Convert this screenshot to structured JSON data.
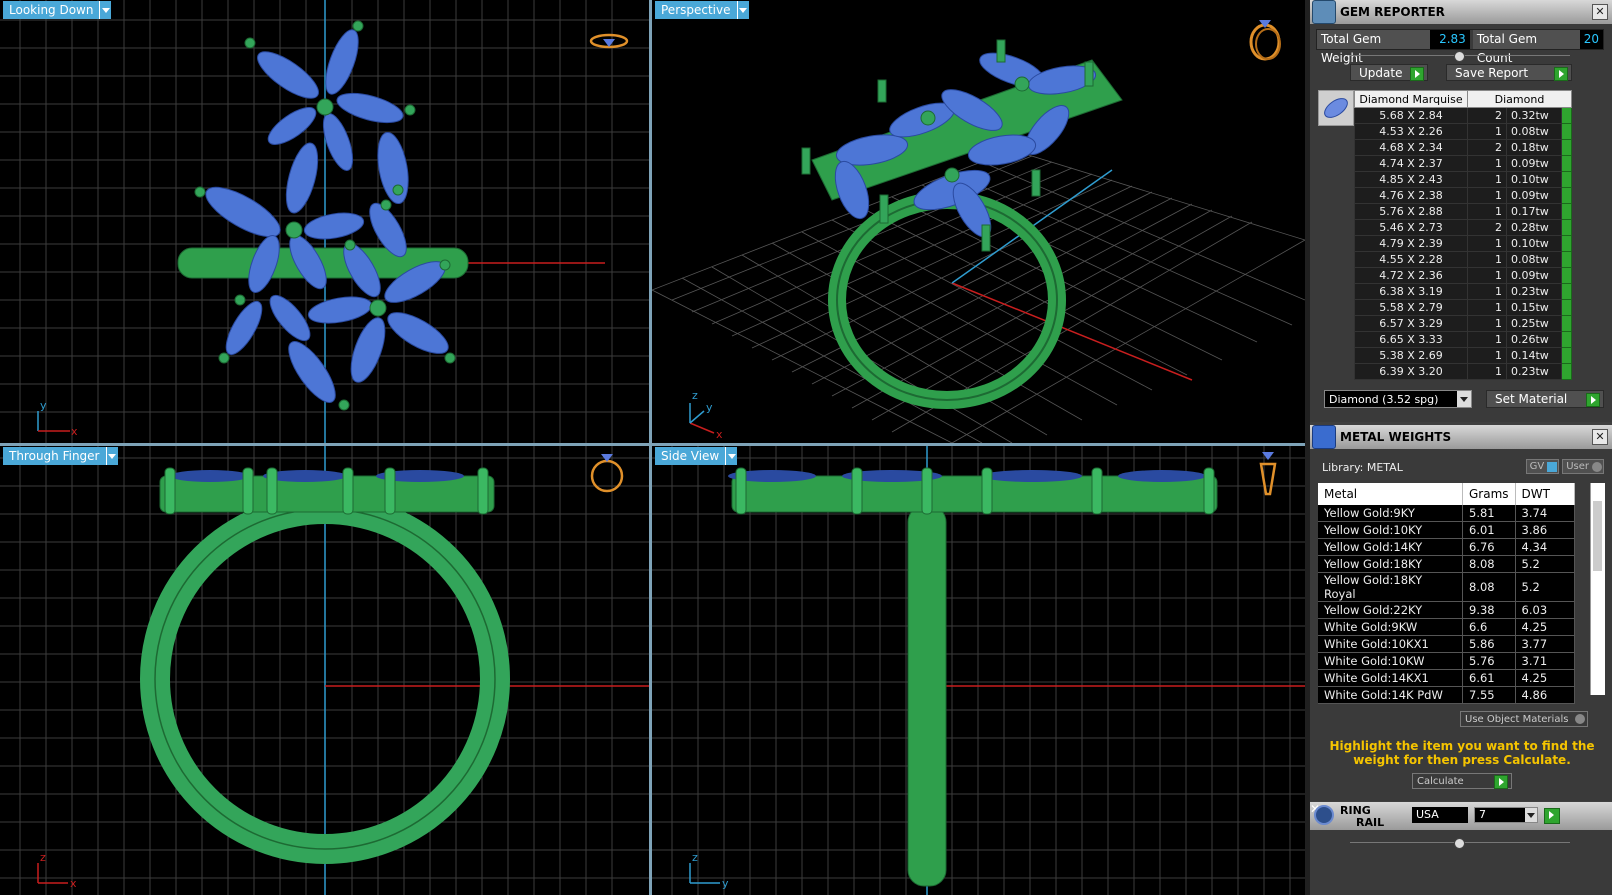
{
  "viewports": {
    "top_left": {
      "label": "Looking Down",
      "axis_v": "y",
      "axis_h": "x"
    },
    "top_right": {
      "label": "Perspective",
      "axis_v": "z",
      "axis_h": "x",
      "axis_d": "y"
    },
    "bottom_left": {
      "label": "Through Finger",
      "axis_v": "z",
      "axis_h": "x"
    },
    "bottom_right": {
      "label": "Side View",
      "axis_v": "z",
      "axis_h": "y"
    }
  },
  "gem_reporter": {
    "title": "GEM REPORTER",
    "total_weight_label": "Total Gem Weight",
    "total_weight_value": "2.83",
    "total_count_label": "Total Gem Count",
    "total_count_value": "20",
    "update_label": "Update",
    "save_report_label": "Save Report",
    "col_shape": "Diamond Marquise",
    "col_material": "Diamond",
    "rows": [
      {
        "size": "5.68 X 2.84",
        "qty": "2",
        "wt": "0.32tw"
      },
      {
        "size": "4.53 X 2.26",
        "qty": "1",
        "wt": "0.08tw"
      },
      {
        "size": "4.68 X 2.34",
        "qty": "2",
        "wt": "0.18tw"
      },
      {
        "size": "4.74 X 2.37",
        "qty": "1",
        "wt": "0.09tw"
      },
      {
        "size": "4.85 X 2.43",
        "qty": "1",
        "wt": "0.10tw"
      },
      {
        "size": "4.76 X 2.38",
        "qty": "1",
        "wt": "0.09tw"
      },
      {
        "size": "5.76 X 2.88",
        "qty": "1",
        "wt": "0.17tw"
      },
      {
        "size": "5.46 X 2.73",
        "qty": "2",
        "wt": "0.28tw"
      },
      {
        "size": "4.79 X 2.39",
        "qty": "1",
        "wt": "0.10tw"
      },
      {
        "size": "4.55 X 2.28",
        "qty": "1",
        "wt": "0.08tw"
      },
      {
        "size": "4.72 X 2.36",
        "qty": "1",
        "wt": "0.09tw"
      },
      {
        "size": "6.38 X 3.19",
        "qty": "1",
        "wt": "0.23tw"
      },
      {
        "size": "5.58 X 2.79",
        "qty": "1",
        "wt": "0.15tw"
      },
      {
        "size": "6.57 X 3.29",
        "qty": "1",
        "wt": "0.25tw"
      },
      {
        "size": "6.65 X 3.33",
        "qty": "1",
        "wt": "0.26tw"
      },
      {
        "size": "5.38 X 2.69",
        "qty": "1",
        "wt": "0.14tw"
      },
      {
        "size": "6.39 X 3.20",
        "qty": "1",
        "wt": "0.23tw"
      }
    ],
    "material_select": "Diamond    (3.52 spg)",
    "set_material_label": "Set Material"
  },
  "metal_weights": {
    "title": "METAL WEIGHTS",
    "library_label": "Library: METAL",
    "gv_label": "GV",
    "user_label": "User",
    "col_metal": "Metal",
    "col_grams": "Grams",
    "col_dwt": "DWT",
    "rows": [
      {
        "metal": "Yellow Gold:9KY",
        "grams": "5.81",
        "dwt": "3.74"
      },
      {
        "metal": "Yellow Gold:10KY",
        "grams": "6.01",
        "dwt": "3.86"
      },
      {
        "metal": "Yellow Gold:14KY",
        "grams": "6.76",
        "dwt": "4.34"
      },
      {
        "metal": "Yellow Gold:18KY",
        "grams": "8.08",
        "dwt": "5.2"
      },
      {
        "metal": "Yellow Gold:18KY Royal",
        "grams": "8.08",
        "dwt": "5.2"
      },
      {
        "metal": "Yellow Gold:22KY",
        "grams": "9.38",
        "dwt": "6.03"
      },
      {
        "metal": "White Gold:9KW",
        "grams": "6.6",
        "dwt": "4.25"
      },
      {
        "metal": "White Gold:10KX1",
        "grams": "5.86",
        "dwt": "3.77"
      },
      {
        "metal": "White Gold:10KW",
        "grams": "5.76",
        "dwt": "3.71"
      },
      {
        "metal": "White Gold:14KX1",
        "grams": "6.61",
        "dwt": "4.25"
      },
      {
        "metal": "White Gold:14K PdW",
        "grams": "7.55",
        "dwt": "4.86"
      }
    ],
    "use_object_label": "Use Object Materials",
    "hint": "Highlight the item you want to find the weight for then press Calculate.",
    "calculate_label": "Calculate"
  },
  "ring_rail": {
    "title_1": "RING",
    "title_2": "RAIL",
    "country": "USA",
    "size": "7"
  }
}
